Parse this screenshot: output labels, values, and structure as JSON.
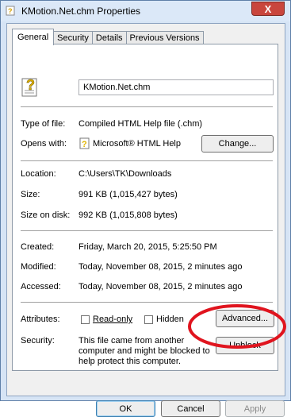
{
  "window": {
    "title": "KMotion.Net.chm Properties",
    "close_glyph": "X"
  },
  "tabs": [
    {
      "label": "General"
    },
    {
      "label": "Security"
    },
    {
      "label": "Details"
    },
    {
      "label": "Previous Versions"
    }
  ],
  "general": {
    "filename": "KMotion.Net.chm",
    "type_label": "Type of file:",
    "type_value": "Compiled HTML Help file (.chm)",
    "opens_label": "Opens with:",
    "opens_value": "Microsoft® HTML Help",
    "change_button": "Change...",
    "location_label": "Location:",
    "location_value": "C:\\Users\\TK\\Downloads",
    "size_label": "Size:",
    "size_value": "991 KB (1,015,427 bytes)",
    "size_on_disk_label": "Size on disk:",
    "size_on_disk_value": "992 KB (1,015,808 bytes)",
    "created_label": "Created:",
    "created_value": "Friday, March 20, 2015, 5:25:50 PM",
    "modified_label": "Modified:",
    "modified_value": "Today, November 08, 2015, 2 minutes ago",
    "accessed_label": "Accessed:",
    "accessed_value": "Today, November 08, 2015, 2 minutes ago",
    "attributes_label": "Attributes:",
    "readonly_label": "Read-only",
    "hidden_label": "Hidden",
    "advanced_button": "Advanced...",
    "security_label": "Security:",
    "security_line1": "This file came from another",
    "security_line2": "computer and might be blocked to",
    "security_line3": "help protect this computer.",
    "unblock_button": "Unblock"
  },
  "footer": {
    "ok": "OK",
    "cancel": "Cancel",
    "apply": "Apply"
  },
  "colors": {
    "annotation_ellipse": "#e0141e",
    "titlebar": "#dbe8f8",
    "close_button": "#c9463d"
  }
}
